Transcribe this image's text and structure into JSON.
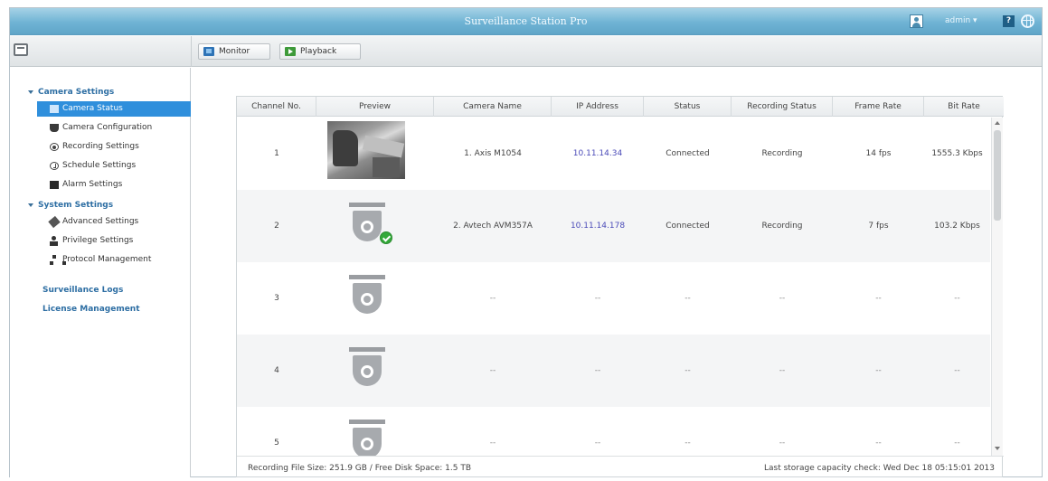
{
  "window": {
    "title": "Surveillance Station Pro",
    "user": "admin ▾",
    "help_glyph": "?"
  },
  "toolbar": {
    "monitor_label": "Monitor",
    "playback_label": "Playback"
  },
  "sidebar": {
    "camera_settings": "Camera Settings",
    "camera_status": "Camera Status",
    "camera_configuration": "Camera Configuration",
    "recording_settings": "Recording Settings",
    "schedule_settings": "Schedule Settings",
    "alarm_settings": "Alarm Settings",
    "system_settings": "System Settings",
    "advanced_settings": "Advanced Settings",
    "privilege_settings": "Privilege Settings",
    "protocol_management": "Protocol Management",
    "surveillance_logs": "Surveillance Logs",
    "license_management": "License Management"
  },
  "table": {
    "columns": [
      "Channel No.",
      "Preview",
      "Camera Name",
      "IP Address",
      "Status",
      "Recording Status",
      "Frame Rate",
      "Bit Rate"
    ],
    "rows": [
      {
        "channel": "1",
        "name": "1. Axis M1054",
        "ip": "10.11.14.34",
        "status": "Connected",
        "recording": "Recording",
        "frame_rate": "14 fps",
        "bit_rate": "1555.3 Kbps"
      },
      {
        "channel": "2",
        "name": "2. Avtech AVM357A",
        "ip": "10.11.14.178",
        "status": "Connected",
        "recording": "Recording",
        "frame_rate": "7 fps",
        "bit_rate": "103.2 Kbps"
      },
      {
        "channel": "3",
        "name": "--",
        "ip": "--",
        "status": "--",
        "recording": "--",
        "frame_rate": "--",
        "bit_rate": "--"
      },
      {
        "channel": "4",
        "name": "--",
        "ip": "--",
        "status": "--",
        "recording": "--",
        "frame_rate": "--",
        "bit_rate": "--"
      },
      {
        "channel": "5",
        "name": "--",
        "ip": "--",
        "status": "--",
        "recording": "--",
        "frame_rate": "--",
        "bit_rate": "--"
      }
    ]
  },
  "footer": {
    "storage": "Recording File Size: 251.9 GB / Free Disk Space: 1.5 TB",
    "last_check": "Last storage capacity check: Wed Dec 18 05:15:01 2013"
  }
}
